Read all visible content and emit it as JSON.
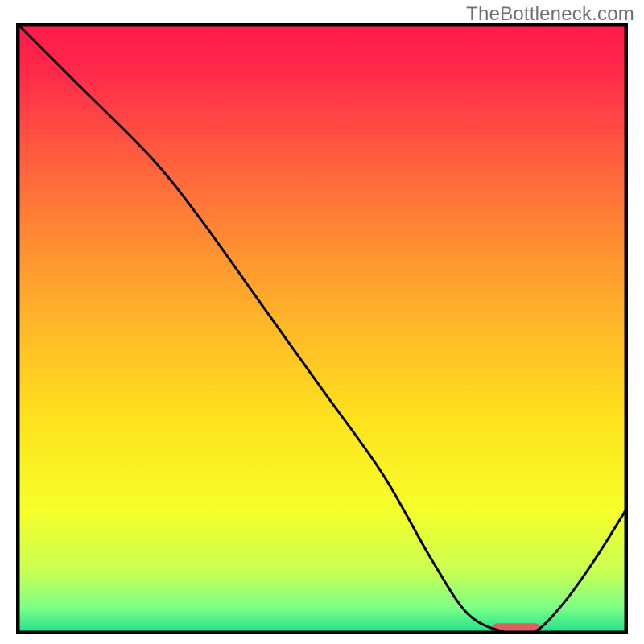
{
  "watermark": "TheBottleneck.com",
  "chart_data": {
    "type": "line",
    "title": "",
    "xlabel": "",
    "ylabel": "",
    "xlim": [
      0,
      100
    ],
    "ylim": [
      0,
      100
    ],
    "grid": false,
    "legend": null,
    "series": [
      {
        "name": "curve",
        "x": [
          0,
          10,
          22,
          30,
          40,
          50,
          60,
          68,
          74,
          80,
          85,
          90,
          95,
          100
        ],
        "values": [
          100,
          90,
          78,
          68,
          54,
          40,
          26,
          12,
          3,
          0,
          0,
          5,
          12,
          20
        ]
      }
    ],
    "highlight_band": {
      "x_start": 78,
      "x_end": 86,
      "y": 0.5
    },
    "gradient_stops": [
      {
        "offset": 0.0,
        "color": "#ff1a4b"
      },
      {
        "offset": 0.08,
        "color": "#ff2a4a"
      },
      {
        "offset": 0.2,
        "color": "#ff5740"
      },
      {
        "offset": 0.35,
        "color": "#ff8a33"
      },
      {
        "offset": 0.5,
        "color": "#ffb928"
      },
      {
        "offset": 0.65,
        "color": "#ffe21e"
      },
      {
        "offset": 0.8,
        "color": "#f6ff2a"
      },
      {
        "offset": 0.9,
        "color": "#c9ff52"
      },
      {
        "offset": 0.96,
        "color": "#7cff86"
      },
      {
        "offset": 1.0,
        "color": "#21e08f"
      }
    ],
    "colors": {
      "frame": "#000000",
      "curve": "#000000",
      "highlight": "#d9625e"
    }
  }
}
